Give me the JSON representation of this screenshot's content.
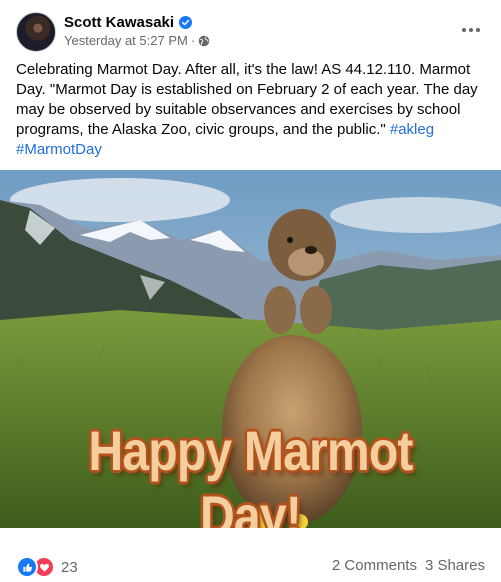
{
  "post": {
    "author": "Scott Kawasaki",
    "timestamp": "Yesterday at 5:27 PM",
    "separator": "·",
    "text": "Celebrating Marmot Day. After all, it's the law! AS 44.12.110. Marmot Day. \"Marmot Day is established on February 2 of each year. The day may be observed by suitable observances and exercises by school programs, the Alaska Zoo, civic groups, and the public.\" ",
    "hashtags": [
      "#akleg",
      "#MarmotDay"
    ],
    "image_caption": "Happy Marmot Day!"
  },
  "engagement": {
    "reaction_count": "23",
    "reactions": [
      "like-icon",
      "love-icon"
    ],
    "comments": "2 Comments",
    "shares": "3 Shares"
  },
  "colors": {
    "link": "#216fdb",
    "like": "#1877f2",
    "love": "#f33e58",
    "verified": "#1877f2",
    "secondary_text": "#65676b"
  }
}
